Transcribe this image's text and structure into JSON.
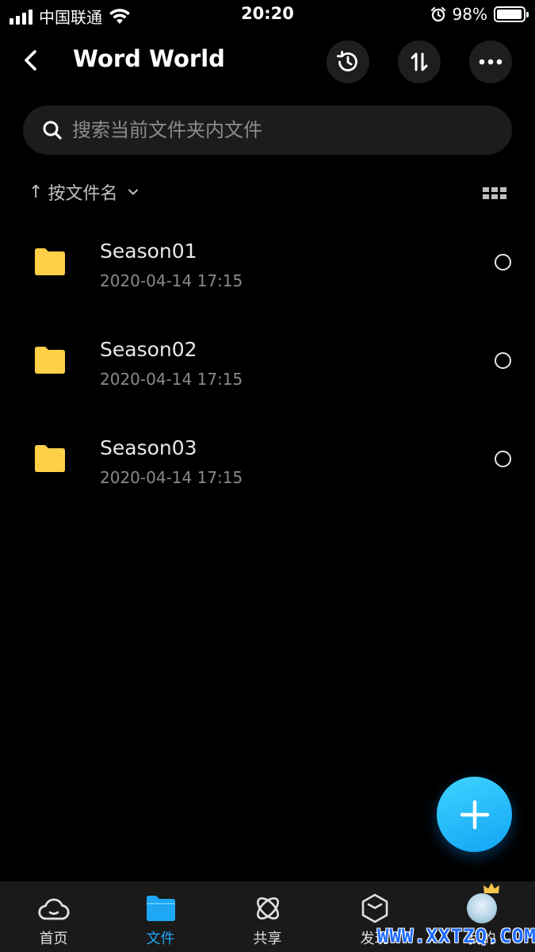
{
  "status_bar": {
    "carrier": "中国联通",
    "time": "20:20",
    "battery_percent": "98%",
    "battery_level": 0.98
  },
  "header": {
    "title": "Word World",
    "back_icon": "back-chevron-icon",
    "history_icon": "history-icon",
    "sort_icon": "transfer-arrows-icon",
    "more_icon": "more-dots-icon"
  },
  "search": {
    "placeholder": "搜索当前文件夹内文件"
  },
  "sort_bar": {
    "arrow": "↑",
    "label": "按文件名",
    "view_icon": "grid-view-icon"
  },
  "files": [
    {
      "name": "Season01",
      "date": "2020-04-14 17:15",
      "icon": "folder-icon"
    },
    {
      "name": "Season02",
      "date": "2020-04-14 17:15",
      "icon": "folder-icon"
    },
    {
      "name": "Season03",
      "date": "2020-04-14 17:15",
      "icon": "folder-icon"
    }
  ],
  "fab": {
    "icon": "plus-icon"
  },
  "bottom_nav": {
    "items": [
      {
        "label": "首页",
        "icon": "cloud-icon",
        "active": false
      },
      {
        "label": "文件",
        "icon": "folder-icon",
        "active": true
      },
      {
        "label": "共享",
        "icon": "atom-icon",
        "active": false
      },
      {
        "label": "发现",
        "icon": "hexagon-box-icon",
        "active": false
      },
      {
        "label": "我的",
        "icon": "avatar",
        "active": false
      }
    ]
  },
  "watermark": "WWW.XXTZQ.COM",
  "colors": {
    "background": "#000000",
    "accent": "#1da7f5",
    "folder": "#fdd047",
    "surface": "#1c1c1c"
  }
}
